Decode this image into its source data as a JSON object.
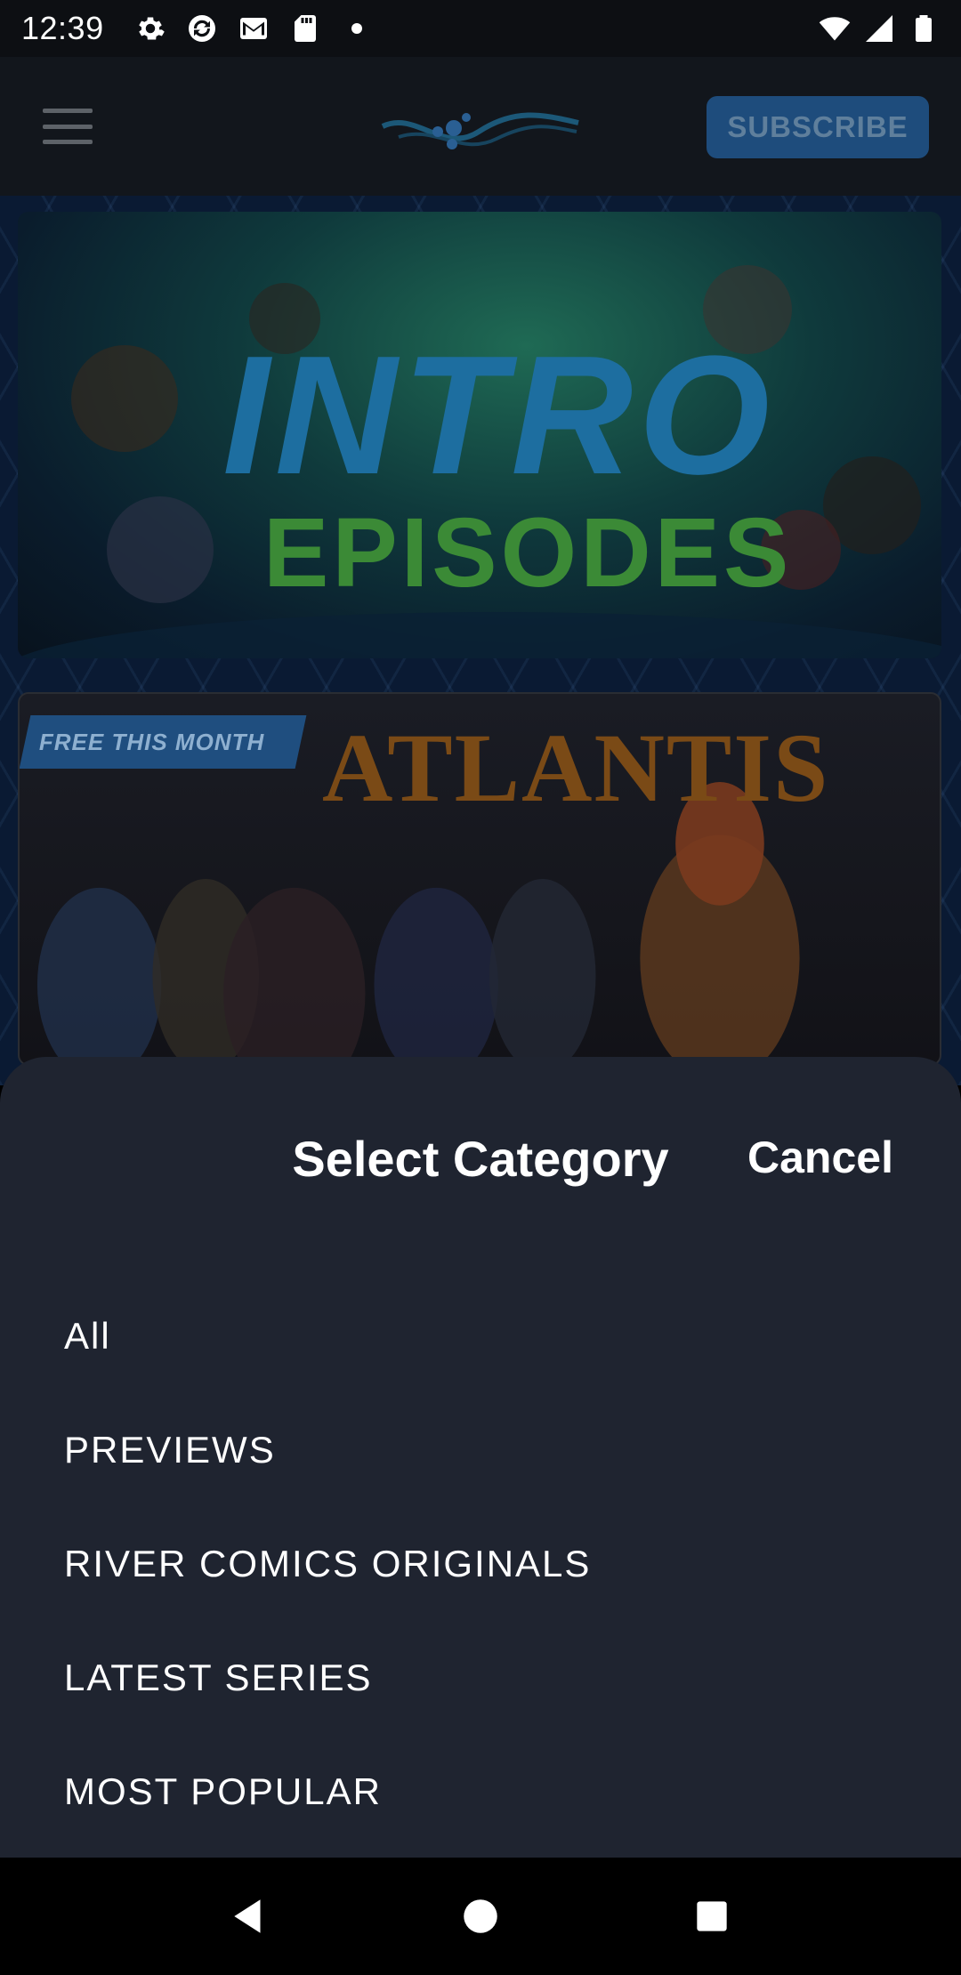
{
  "status_bar": {
    "time": "12:39",
    "left_icons": [
      "gear-icon",
      "sync-icon",
      "gmail-icon",
      "sd-card-icon",
      "dot-icon"
    ],
    "right_icons": [
      "wifi-icon",
      "signal-icon",
      "battery-icon"
    ]
  },
  "header": {
    "subscribe_label": "SUBSCRIBE"
  },
  "banners": {
    "intro": {
      "line1": "INTRO",
      "line2": "EPISODES"
    },
    "atlantis": {
      "tag": "FREE THIS MONTH",
      "title": "ATLANTIS"
    }
  },
  "sheet": {
    "title": "Select Category",
    "cancel_label": "Cancel",
    "items": [
      {
        "label": "All"
      },
      {
        "label": "PREVIEWS"
      },
      {
        "label": "RIVER COMICS ORIGINALS"
      },
      {
        "label": "LATEST SERIES"
      },
      {
        "label": "MOST POPULAR"
      }
    ]
  },
  "colors": {
    "sheet_bg": "#1f2430",
    "header_bg": "#12161c",
    "subscribe_bg": "#1e4c7c"
  }
}
